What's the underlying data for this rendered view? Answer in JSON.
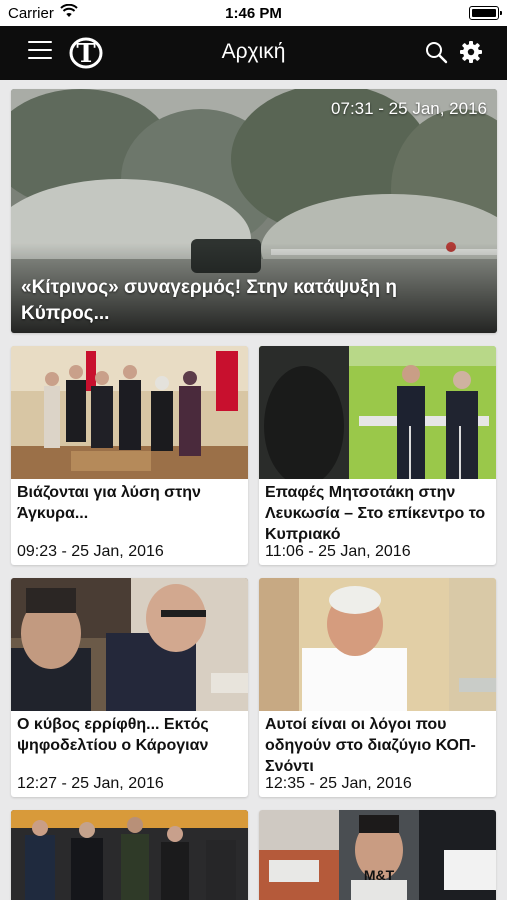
{
  "status_bar": {
    "carrier": "Carrier",
    "time": "1:46 PM"
  },
  "nav": {
    "title": "Αρχική",
    "logo_letter": "T"
  },
  "hero": {
    "timestamp": "07:31 - 25 Jan, 2016",
    "headline": "«Κίτρινος» συναγερμός! Στην κατάψυξη η Κύπρος..."
  },
  "articles": [
    {
      "headline": "Βιάζονται για λύση στην Άγκυρα...",
      "timestamp": "09:23 - 25 Jan, 2016"
    },
    {
      "headline": "Επαφές Μητσοτάκη στην Λευκωσία – Στο επίκεντρο το Κυπριακό",
      "timestamp": "11:06 - 25 Jan, 2016"
    },
    {
      "headline": "Ο κύβος ερρίφθη... Εκτός ψηφοδελτίου ο Κάρογιαν",
      "timestamp": "12:27 - 25 Jan, 2016"
    },
    {
      "headline": "Αυτοί είναι οι λόγοι που οδηγούν στο διαζύγιο ΚΟΠ- Σνόντι",
      "timestamp": "12:35 - 25 Jan, 2016"
    }
  ],
  "partial_photo_text": "M&T",
  "colors": {
    "nav_background": "#0d0d0d",
    "page_background": "#e9e9ea"
  },
  "icons": [
    "wifi-icon",
    "battery-icon",
    "menu-icon",
    "logo-icon",
    "search-icon",
    "settings-icon"
  ]
}
